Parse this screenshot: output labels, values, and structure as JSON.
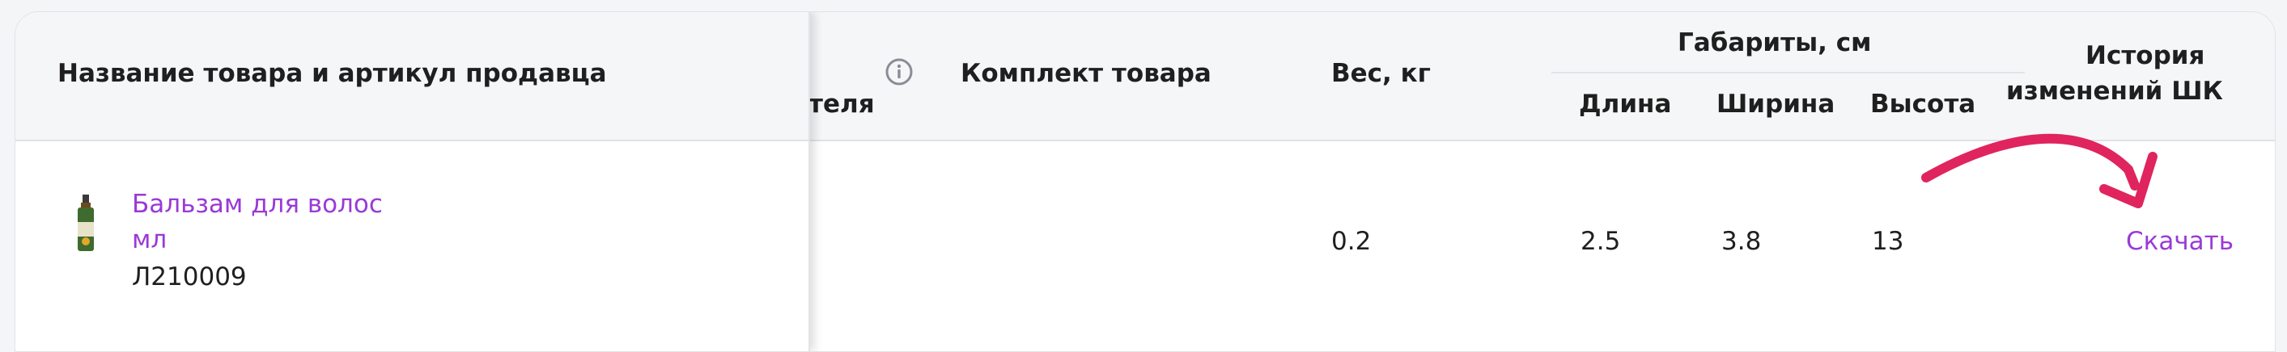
{
  "table": {
    "columns": {
      "product": "Название товара и артикул продавца",
      "hidden_partial": "теля",
      "kit": "Комплект товара",
      "weight": "Вес, кг",
      "dimensions_group": "Габариты, см",
      "length": "Длина",
      "width": "Ширина",
      "height": "Высота",
      "barcode_history_line1": "История",
      "barcode_history_line2": "изменений ШК"
    },
    "rows": [
      {
        "product_name_line1": "Бальзам для волос",
        "product_name_line2": "мл",
        "seller_article": "Л210009",
        "weight": "0.2",
        "length": "2.5",
        "width": "3.8",
        "height": "13",
        "history_link": "Скачать"
      }
    ]
  },
  "icons": {
    "info": "info-icon",
    "product": "balm-bottle-thumbnail",
    "annotation": "curved-arrow-annotation"
  },
  "colors": {
    "link": "#9a3ad6",
    "annotation_arrow": "#e0245e",
    "header_bg": "#f5f6f8"
  }
}
